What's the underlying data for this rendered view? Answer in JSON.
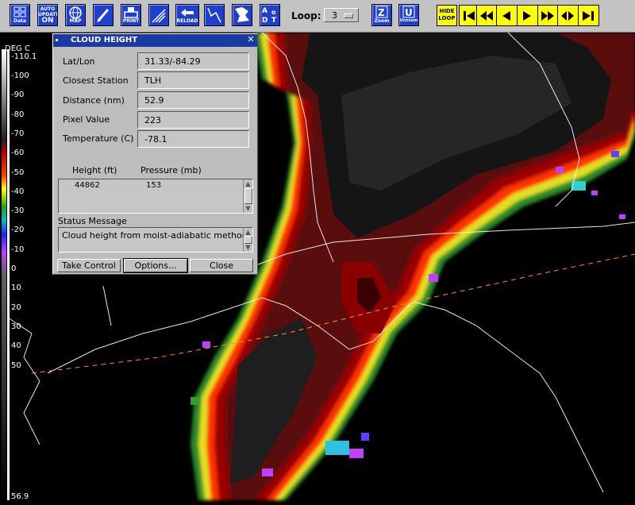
{
  "toolbar": {
    "buttons": [
      {
        "name": "data-button",
        "label": "Data"
      },
      {
        "name": "auto-update-button",
        "label_top": "AUTO UPDATE",
        "label": "ON"
      },
      {
        "name": "map-button",
        "label": "MAP"
      },
      {
        "name": "draw-button",
        "label": ""
      },
      {
        "name": "print-button",
        "label": "PRINT"
      },
      {
        "name": "enhance-button",
        "label": ""
      },
      {
        "name": "reload-button",
        "label": "RELOAD"
      },
      {
        "name": "line-button",
        "label": ""
      },
      {
        "name": "shape-button",
        "label": ""
      },
      {
        "name": "distance-button",
        "label": "D T"
      }
    ],
    "loop_label": "Loop:",
    "loop_value": "3",
    "zoom_label": "Zoom",
    "unzoom_label": "Unzoom",
    "hide_loop_label": "HIDE LOOP"
  },
  "scale": {
    "unit": "DEG C",
    "top_value": "-110.1",
    "bottom_value": "56.9",
    "ticks": [
      "-100",
      "-90",
      "-80",
      "-70",
      "-60",
      "-50",
      "-40",
      "-30",
      "-20",
      "-10",
      "0",
      "10",
      "20",
      "30",
      "40",
      "50"
    ]
  },
  "dialog": {
    "title": "CLOUD HEIGHT",
    "rows": [
      {
        "label": "Lat/Lon",
        "value": "31.33/-84.29"
      },
      {
        "label": "Closest Station",
        "value": "TLH"
      },
      {
        "label": "Distance (nm)",
        "value": "52.9"
      },
      {
        "label": "Pixel Value",
        "value": "223"
      },
      {
        "label": "Temperature (C)",
        "value": "-78.1"
      }
    ],
    "height_header": "Height (ft)",
    "pressure_header": "Pressure (mb)",
    "height_value": "44862",
    "pressure_value": "153",
    "status_label": "Status Message",
    "status_message": "Cloud height from moist-adiabatic method.",
    "buttons": {
      "take_control": "Take Control",
      "options": "Options...",
      "close": "Close"
    }
  },
  "colors": {
    "toolbar_bg": "#c3c3c3",
    "button_blue": "#1f3fd0",
    "control_yellow": "#ffff00",
    "dialog_title": "#1b3aa6"
  }
}
